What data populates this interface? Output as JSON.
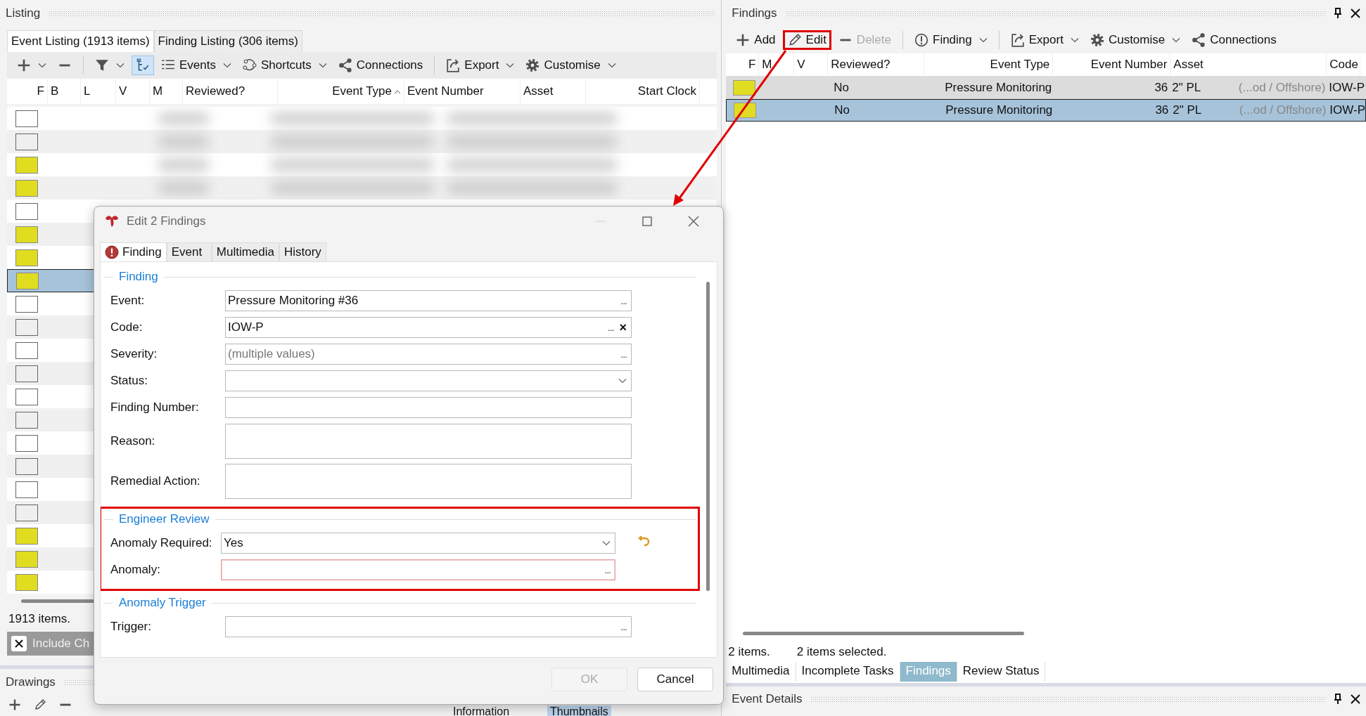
{
  "listing": {
    "title": "Listing",
    "tabs": [
      {
        "label": "Event Listing (1913 items)",
        "selected": true
      },
      {
        "label": "Finding Listing (306 items)",
        "selected": false
      }
    ],
    "toolbar": [
      {
        "kind": "button",
        "dropdown": true,
        "pressed": false
      },
      {
        "kind": "button",
        "dropdown": false,
        "pressed": false
      },
      {
        "kind": "separator"
      },
      {
        "kind": "button",
        "dropdown": true,
        "pressed": false
      },
      {
        "kind": "button",
        "dropdown": false,
        "pressed": true
      },
      {
        "kind": "button",
        "label": "Events",
        "dropdown": true,
        "pressed": false
      },
      {
        "kind": "button",
        "label": "Shortcuts",
        "dropdown": true,
        "pressed": false
      },
      {
        "kind": "button",
        "label": "Connections",
        "dropdown": false,
        "pressed": false
      },
      {
        "kind": "separator"
      },
      {
        "kind": "button",
        "label": "Export",
        "dropdown": true,
        "pressed": false
      },
      {
        "kind": "button",
        "label": "Customise",
        "dropdown": true,
        "pressed": false
      }
    ],
    "columns": [
      {
        "label": "F",
        "sorted": false
      },
      {
        "label": "B",
        "sorted": false
      },
      {
        "label": "L",
        "sorted": false
      },
      {
        "label": "V",
        "sorted": false
      },
      {
        "label": "M",
        "sorted": false
      },
      {
        "label": "Reviewed?",
        "sorted": false
      },
      {
        "label": "Event Type",
        "sorted": true
      },
      {
        "label": "Event Number",
        "sorted": false
      },
      {
        "label": "Asset",
        "sorted": false
      },
      {
        "label": "Start Clock",
        "sorted": false
      }
    ],
    "rows": [
      {
        "flagged": false,
        "selected": false
      },
      {
        "flagged": false,
        "selected": false
      },
      {
        "flagged": true,
        "selected": false
      },
      {
        "flagged": true,
        "selected": false
      },
      {
        "flagged": false,
        "selected": false
      },
      {
        "flagged": true,
        "selected": false
      },
      {
        "flagged": true,
        "selected": false
      },
      {
        "flagged": true,
        "selected": true
      },
      {
        "flagged": false,
        "selected": false
      },
      {
        "flagged": false,
        "selected": false
      },
      {
        "flagged": false,
        "selected": false
      },
      {
        "flagged": false,
        "selected": false
      },
      {
        "flagged": false,
        "selected": false
      },
      {
        "flagged": false,
        "selected": false
      },
      {
        "flagged": false,
        "selected": false
      },
      {
        "flagged": false,
        "selected": false
      },
      {
        "flagged": false,
        "selected": false
      },
      {
        "flagged": false,
        "selected": false
      },
      {
        "flagged": true,
        "selected": false
      },
      {
        "flagged": true,
        "selected": false
      },
      {
        "flagged": true,
        "selected": false
      }
    ],
    "status": "1913 items.",
    "include": {
      "label": "Include Ch",
      "checked": true
    }
  },
  "drawings": {
    "title": "Drawings",
    "tabs": [
      {
        "label": "Information",
        "selected": false
      },
      {
        "label": "Thumbnails",
        "selected": true
      }
    ]
  },
  "findings": {
    "title": "Findings",
    "toolbar": [
      {
        "kind": "button",
        "label": "Add",
        "dropdown": false,
        "disabled": false,
        "annotated": false
      },
      {
        "kind": "button",
        "label": "Edit",
        "dropdown": false,
        "disabled": false,
        "annotated": true
      },
      {
        "kind": "button",
        "label": "Delete",
        "dropdown": false,
        "disabled": true,
        "annotated": false
      },
      {
        "kind": "separator"
      },
      {
        "kind": "button",
        "label": "Finding",
        "dropdown": true,
        "disabled": false,
        "annotated": false
      },
      {
        "kind": "separator"
      },
      {
        "kind": "button",
        "label": "Export",
        "dropdown": true,
        "disabled": false,
        "annotated": false
      },
      {
        "kind": "button",
        "label": "Customise",
        "dropdown": true,
        "disabled": false,
        "annotated": false
      },
      {
        "kind": "button",
        "label": "Connections",
        "dropdown": false,
        "disabled": false,
        "annotated": false
      }
    ],
    "columns": [
      "F",
      "M",
      "V",
      "Reviewed?",
      "Event Type",
      "Event Number",
      "Asset",
      "Code"
    ],
    "rows": [
      {
        "flagged": true,
        "reviewed": "No",
        "event_type": "Pressure Monitoring",
        "event_number": "36",
        "asset": "2\" PL",
        "column_9": "(...od / Offshore)",
        "code": "IOW-P",
        "selected": true,
        "focused": false
      },
      {
        "flagged": true,
        "reviewed": "No",
        "event_type": "Pressure Monitoring",
        "event_number": "36",
        "asset": "2\" PL",
        "column_9": "(...od / Offshore)",
        "code": "IOW-P",
        "selected": true,
        "focused": true
      }
    ],
    "status": "2 items.",
    "selection_status": "2 items selected.",
    "tabs": [
      {
        "label": "Multimedia",
        "selected": false
      },
      {
        "label": "Incomplete Tasks",
        "selected": false
      },
      {
        "label": "Findings",
        "selected": true
      },
      {
        "label": "Review Status",
        "selected": false
      }
    ],
    "details_title": "Event Details"
  },
  "dialog": {
    "title": "Edit 2 Findings",
    "tabs": [
      {
        "label": "Finding",
        "selected": true,
        "error": true
      },
      {
        "label": "Event",
        "selected": false,
        "error": false
      },
      {
        "label": "Multimedia",
        "selected": false,
        "error": false
      },
      {
        "label": "History",
        "selected": false,
        "error": false
      }
    ],
    "sections": [
      {
        "title": "Finding",
        "annotated": false,
        "fields": [
          {
            "label": "Event:",
            "kind": "text",
            "value": "Pressure Monitoring #36",
            "browse": "...",
            "invalid": false,
            "revertable": false
          },
          {
            "label": "Code:",
            "kind": "text",
            "value": "IOW-P",
            "browse": "...",
            "clear": "×",
            "invalid": false,
            "revertable": false
          },
          {
            "label": "Severity:",
            "kind": "text",
            "placeholder": "(multiple values)",
            "browse": "...",
            "invalid": false,
            "revertable": false
          },
          {
            "label": "Status:",
            "kind": "dropdown",
            "invalid": false,
            "revertable": false
          },
          {
            "label": "Finding Number:",
            "kind": "text",
            "invalid": false,
            "revertable": false
          },
          {
            "label": "Reason:",
            "kind": "textarea",
            "invalid": false,
            "revertable": false
          },
          {
            "label": "Remedial Action:",
            "kind": "textarea",
            "invalid": false,
            "revertable": false
          }
        ]
      },
      {
        "title": "Engineer Review",
        "annotated": true,
        "fields": [
          {
            "label": "Anomaly Required:",
            "kind": "dropdown",
            "value": "Yes",
            "invalid": false,
            "revertable": true
          },
          {
            "label": "Anomaly:",
            "kind": "text",
            "browse": "...",
            "invalid": true,
            "revertable": false
          }
        ]
      },
      {
        "title": "Anomaly Trigger",
        "annotated": false,
        "fields": [
          {
            "label": "Trigger:",
            "kind": "text",
            "browse": "...",
            "invalid": false,
            "revertable": false
          }
        ]
      }
    ],
    "buttons": [
      {
        "label": "OK",
        "disabled": true
      },
      {
        "label": "Cancel",
        "disabled": false
      }
    ]
  }
}
